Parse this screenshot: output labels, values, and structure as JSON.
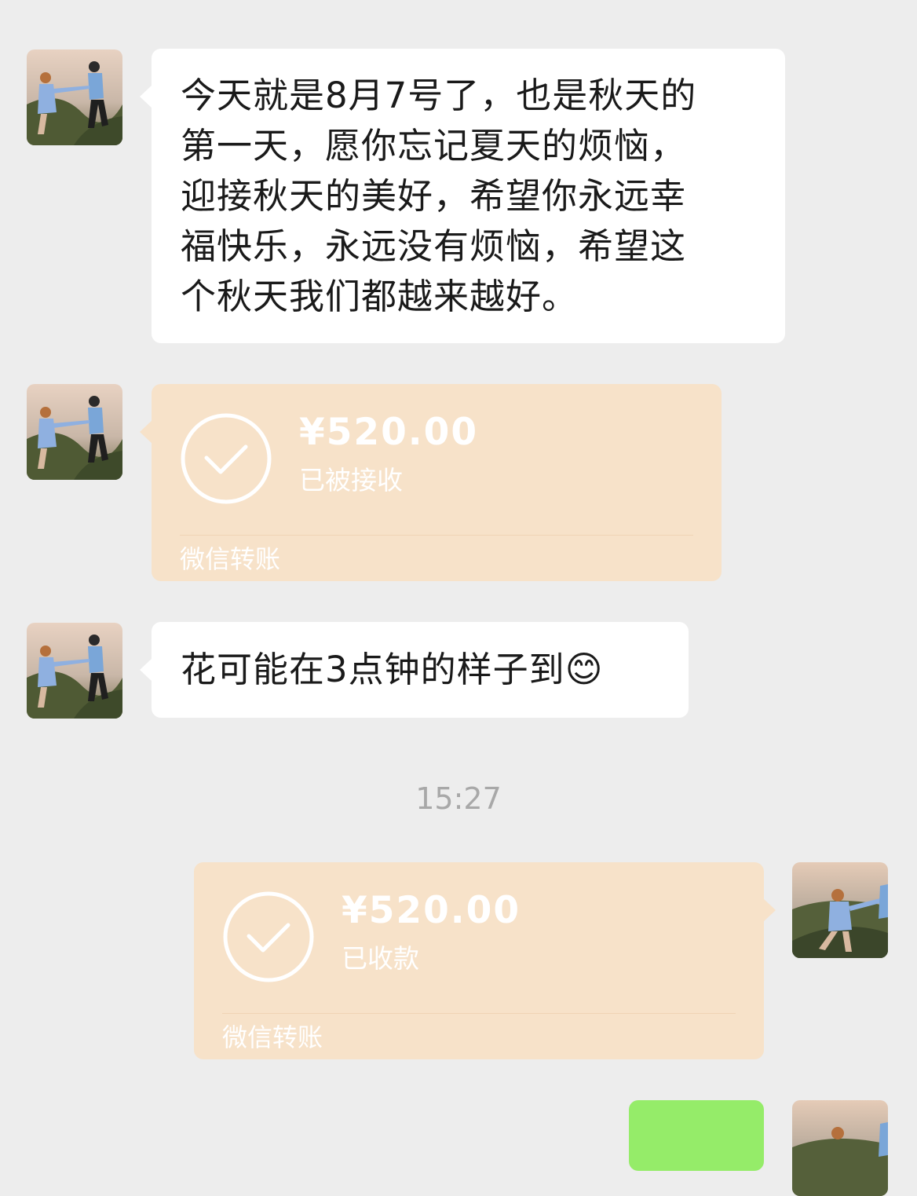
{
  "messages": {
    "greeting": {
      "lines": [
        "今天就是8月7号了，也是秋天的",
        "第一天，愿你忘记夏天的烦恼，",
        "迎接秋天的美好，希望你永远幸",
        "福快乐，永远没有烦恼，希望这",
        "个秋天我们都越来越好。"
      ]
    },
    "transfer_in": {
      "amount": "¥520.00",
      "status": "已被接收",
      "brand": "微信转账"
    },
    "flower": {
      "text": "花可能在3点钟的样子到",
      "emoji": "😊"
    },
    "timestamp": "15:27",
    "transfer_out": {
      "amount": "¥520.00",
      "status": "已收款",
      "brand": "微信转账"
    }
  },
  "colors": {
    "background": "#ededed",
    "bubble": "#ffffff",
    "transfer_card": "#f7e2c9",
    "my_bubble": "#95ec69",
    "timestamp": "#a8a8a8"
  }
}
